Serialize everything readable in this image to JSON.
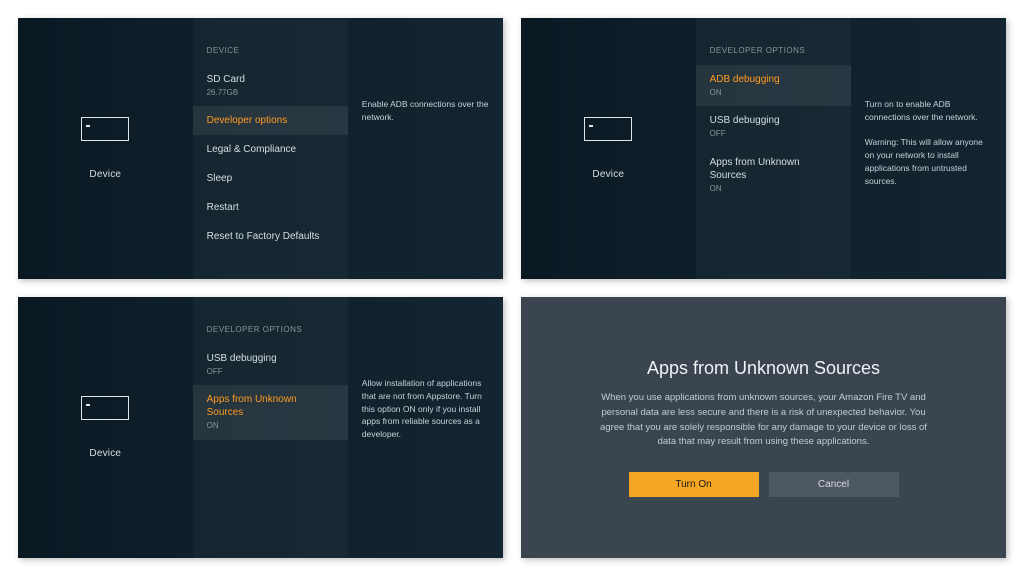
{
  "nav_title": "Device",
  "panels": {
    "device_menu": {
      "heading": "DEVICE",
      "items": [
        {
          "label": "SD Card",
          "sub": "26.77GB"
        },
        {
          "label": "Developer options",
          "selected": true
        },
        {
          "label": "Legal & Compliance"
        },
        {
          "label": "Sleep"
        },
        {
          "label": "Restart"
        },
        {
          "label": "Reset to Factory Defaults"
        }
      ],
      "description": "Enable ADB connections over the network."
    },
    "dev_adb": {
      "heading": "DEVELOPER OPTIONS",
      "items": [
        {
          "label": "ADB debugging",
          "sub": "ON",
          "selected": true
        },
        {
          "label": "USB debugging",
          "sub": "OFF"
        },
        {
          "label": "Apps from Unknown Sources",
          "sub": "ON"
        }
      ],
      "description": "Turn on to enable ADB connections over the network.\n\nWarning: This will allow anyone on your network to install applications from untrusted sources."
    },
    "dev_unknown": {
      "heading": "DEVELOPER OPTIONS",
      "items": [
        {
          "label": "USB debugging",
          "sub": "OFF"
        },
        {
          "label": "Apps from Unknown Sources",
          "sub": "ON",
          "selected": true
        }
      ],
      "description": "Allow installation of applications that are not from Appstore. Turn this option ON only if you install apps from reliable sources as a developer."
    },
    "dialog": {
      "title": "Apps from Unknown Sources",
      "body": "When you use applications from unknown sources, your Amazon Fire TV and personal data are less secure and there is a risk of unexpected behavior. You agree that you are solely responsible for any damage to your device or loss of data that may result from using these applications.",
      "primary": "Turn On",
      "secondary": "Cancel"
    }
  }
}
